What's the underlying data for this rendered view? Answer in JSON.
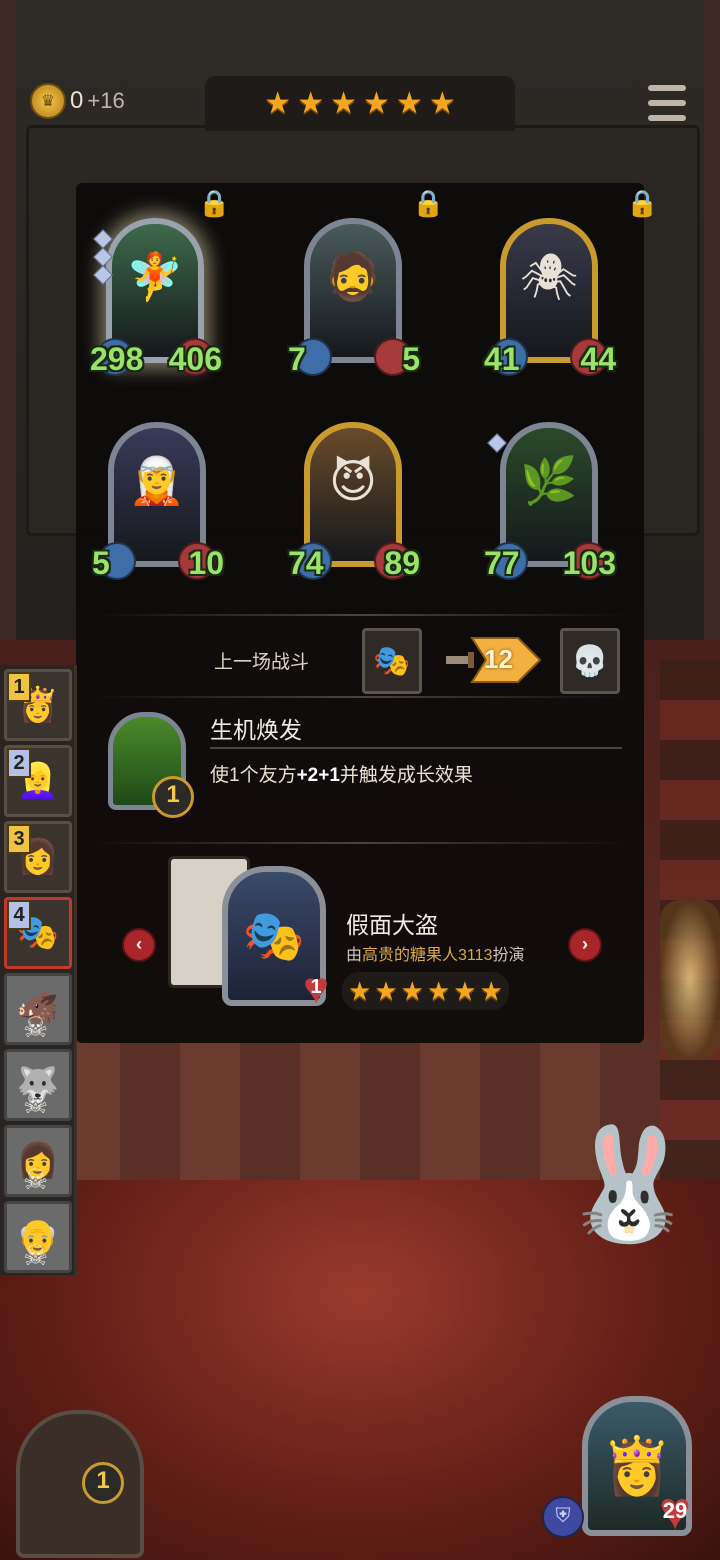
{
  "top_bar": {
    "gold": "0",
    "gold_income": "+16",
    "tier_stars": 6,
    "menu_icon": "hamburger-menu-icon"
  },
  "shop_cards": [
    {
      "attack": "298",
      "health": "406",
      "frame": "silver",
      "icon": "fairy-portrait",
      "art_color": "#3d6a4a"
    },
    {
      "attack": "7",
      "health": "5",
      "frame": "silver",
      "icon": "bearded-writer-portrait",
      "art_color": "#4a5a5a"
    },
    {
      "attack": "41",
      "health": "44",
      "frame": "gold",
      "icon": "mushroom-spider-portrait",
      "art_color": "#3a3a4a"
    },
    {
      "attack": "5",
      "health": "10",
      "frame": "silver",
      "icon": "elf-witch-portrait",
      "art_color": "#3a3a5a"
    },
    {
      "attack": "74",
      "health": "89",
      "frame": "gold",
      "icon": "grinning-devil-portrait",
      "art_color": "#6a4a2a"
    },
    {
      "attack": "77",
      "health": "103",
      "frame": "silver",
      "icon": "plant-creature-portrait",
      "art_color": "#2a4a2a"
    }
  ],
  "last_battle": {
    "label": "上一场战斗",
    "damage": "12",
    "own_icon": "masked-thief-portrait",
    "enemy_icon": "defeated-skull-portrait"
  },
  "spell": {
    "title": "生机焕发",
    "description_prefix": "使1个友方",
    "description_buff": "+2+1",
    "description_suffix": "并触发成长效果",
    "cost": "1"
  },
  "hero": {
    "name": "假面大盗",
    "played_by_prefix": "由",
    "played_by_name": "高贵的糖果人",
    "played_by_level": "3113",
    "played_by_suffix": "扮演",
    "health": "1",
    "stars": 6,
    "prev_icon": "chevron-left-icon",
    "next_icon": "chevron-right-icon"
  },
  "side_list": [
    {
      "rank": "1",
      "state": "alive",
      "icon": "ice-queen-portrait"
    },
    {
      "rank": "2",
      "state": "alive",
      "icon": "blonde-princess-portrait"
    },
    {
      "rank": "3",
      "state": "alive",
      "icon": "golden-hair-portrait"
    },
    {
      "rank": "4",
      "state": "active",
      "icon": "masked-thief-portrait"
    },
    {
      "rank": "",
      "state": "dead",
      "icon": "beast-portrait"
    },
    {
      "rank": "",
      "state": "dead",
      "icon": "wolf-portrait"
    },
    {
      "rank": "",
      "state": "dead",
      "icon": "lady-portrait"
    },
    {
      "rank": "",
      "state": "dead",
      "icon": "old-man-portrait"
    }
  ],
  "bottom": {
    "chest_count": "1",
    "player_health": "29",
    "player_icon": "ice-queen-portrait",
    "shield_icon": "shield-icon",
    "bunny_icon": "bunny-trumpet-icon"
  }
}
